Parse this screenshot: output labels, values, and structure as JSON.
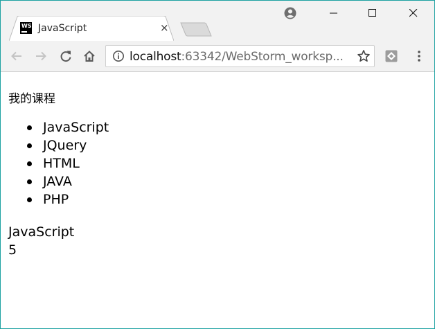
{
  "browser": {
    "tab": {
      "title": "JavaScript",
      "favicon_text": "WS",
      "close_glyph": "×"
    },
    "address_bar": {
      "url_host": "localhost",
      "url_rest": ":63342/WebStorm_worksp..."
    },
    "icons": [
      "back-icon",
      "forward-icon",
      "reload-icon",
      "home-icon",
      "info-icon",
      "star-icon",
      "extension-icon",
      "menu-icon",
      "account-icon",
      "minimize-icon",
      "maximize-icon",
      "close-icon"
    ],
    "colors": {
      "frame": "#f2f2f2",
      "window_border": "#1ba1a1"
    }
  },
  "page": {
    "heading": "我的课程",
    "courses": [
      "JavaScript",
      "JQuery",
      "HTML",
      "JAVA",
      "PHP"
    ],
    "output": [
      "JavaScript",
      "5"
    ]
  }
}
